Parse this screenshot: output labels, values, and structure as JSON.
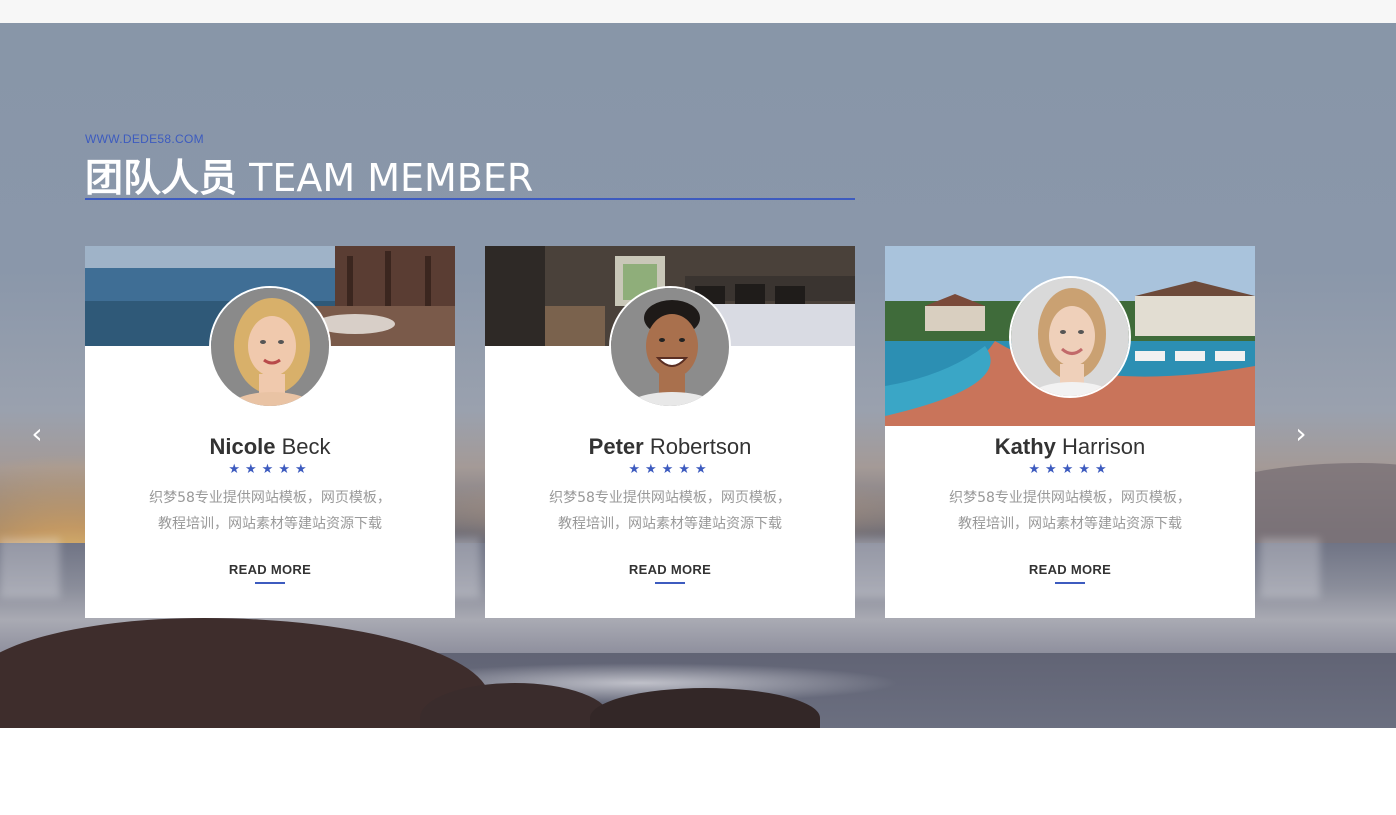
{
  "section": {
    "subtitle": "WWW.DEDE58.COM",
    "title_cn": "团队人员",
    "title_en": "TEAM MEMBER"
  },
  "nav": {
    "prev_icon": "chevron-left-icon",
    "next_icon": "chevron-right-icon",
    "prev_glyph": "‹",
    "next_glyph": "›"
  },
  "members": [
    {
      "first": "Nicole",
      "last": "Beck",
      "stars": "★★★★★",
      "desc_line1": "织梦58专业提供网站模板，网页模板，",
      "desc_line2": "教程培训，网站素材等建站资源下载",
      "more": "READ MORE"
    },
    {
      "first": "Peter",
      "last": "Robertson",
      "stars": "★★★★★",
      "desc_line1": "织梦58专业提供网站模板，网页模板，",
      "desc_line2": "教程培训，网站素材等建站资源下载",
      "more": "READ MORE"
    },
    {
      "first": "Kathy",
      "last": "Harrison",
      "stars": "★★★★★",
      "desc_line1": "织梦58专业提供网站模板，网页模板，",
      "desc_line2": "教程培训，网站素材等建站资源下载",
      "more": "READ MORE"
    }
  ],
  "colors": {
    "accent": "#3d5bbf",
    "text_dark": "#333333",
    "text_muted": "#999999"
  }
}
